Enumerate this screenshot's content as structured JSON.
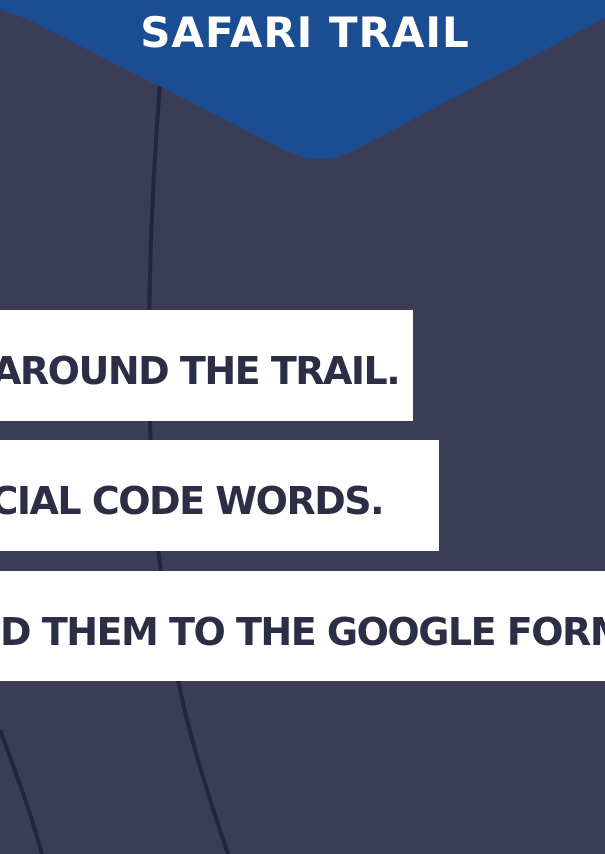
{
  "header": {
    "title": "SAFARI TRAIL"
  },
  "instructions": [
    {
      "text": "AROUND THE TRAIL."
    },
    {
      "text": "ECIAL CODE WORDS."
    },
    {
      "text": "DD THEM TO THE GOOGLE FORM"
    }
  ],
  "colors": {
    "background": "#3b3d57",
    "badge": "#1b4d93",
    "strip": "#ffffff",
    "strip_text": "#2c2e45",
    "trail_line": "#23253a"
  }
}
